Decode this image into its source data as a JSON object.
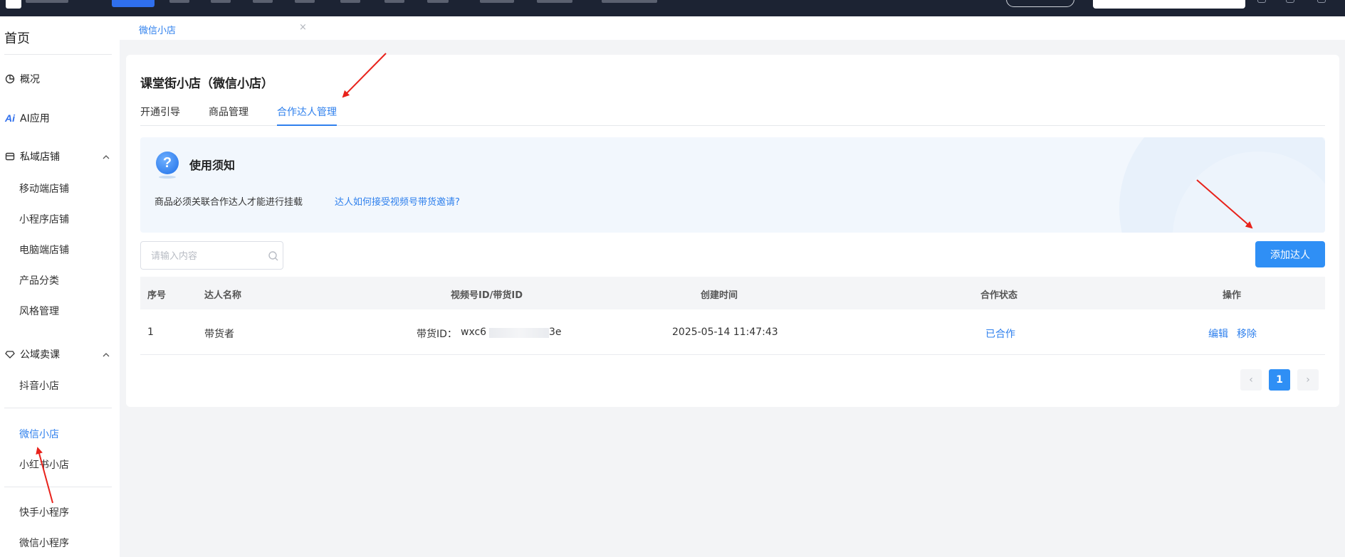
{
  "sidebar": {
    "home": "首页",
    "groups": [
      {
        "label": "概况",
        "icon": "pie-chart-icon"
      },
      {
        "label": "AI应用",
        "icon": "ai-icon"
      },
      {
        "label": "私域店铺",
        "icon": "store-icon"
      },
      {
        "label": "公域卖课",
        "icon": "diamond-icon"
      }
    ],
    "private_items": [
      "移动端店铺",
      "小程序店铺",
      "电脑端店铺",
      "产品分类",
      "风格管理"
    ],
    "public_items": [
      "抖音小店"
    ],
    "shop_items": [
      "微信小店",
      "小红书小店"
    ],
    "mini_items": [
      "快手小程序",
      "微信小程序"
    ]
  },
  "breadcrumb": {
    "tab": "微信小店",
    "close": "×"
  },
  "page": {
    "title": "课堂街小店（微信小店）",
    "tabs": [
      "开通引导",
      "商品管理",
      "合作达人管理"
    ],
    "active_tab": "合作达人管理"
  },
  "notice": {
    "title": "使用须知",
    "icon_glyph": "?",
    "text": "商品必须关联合作达人才能进行挂载",
    "link": "达人如何接受视频号带货邀请?"
  },
  "search": {
    "placeholder": "请输入内容"
  },
  "add_button": "添加达人",
  "table": {
    "headers": [
      "序号",
      "达人名称",
      "视频号ID/带货ID",
      "创建时间",
      "合作状态",
      "操作"
    ],
    "rows": [
      {
        "index": "1",
        "name": "带货者",
        "id_prefix": "带货ID：",
        "id_start": "wxc6",
        "id_end": "3e",
        "created": "2025-05-14 11:47:43",
        "status": "已合作",
        "edit": "编辑",
        "remove": "移除"
      }
    ]
  },
  "pagination": {
    "prev": "‹",
    "current": "1",
    "next": "›"
  },
  "colors": {
    "accent": "#2f80ed",
    "button": "#2f8ff5",
    "topbar": "#1c2333",
    "annotation": "#e8221b"
  }
}
